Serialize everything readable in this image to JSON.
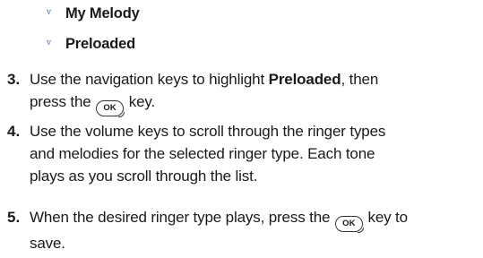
{
  "sub_items": [
    {
      "bullet": "v",
      "label": "My Melody"
    },
    {
      "bullet": "v",
      "label": "Preloaded"
    }
  ],
  "steps": [
    {
      "number": "3.",
      "line1_pre": "Use the navigation keys to highlight ",
      "line1_bold": "Preloaded",
      "line1_post": ", then",
      "line2_pre": "press the ",
      "line2_post": " key."
    },
    {
      "number": "4.",
      "line1": "Use the volume keys to scroll through the ringer types",
      "line2": "and melodies for the selected ringer type. Each tone",
      "line3": "plays as you scroll through the list."
    },
    {
      "number": "5.",
      "line1_pre": "When the desired ringer type plays, press the ",
      "line1_post": " key to",
      "line2": "save."
    }
  ],
  "ok_key_label": "OK"
}
